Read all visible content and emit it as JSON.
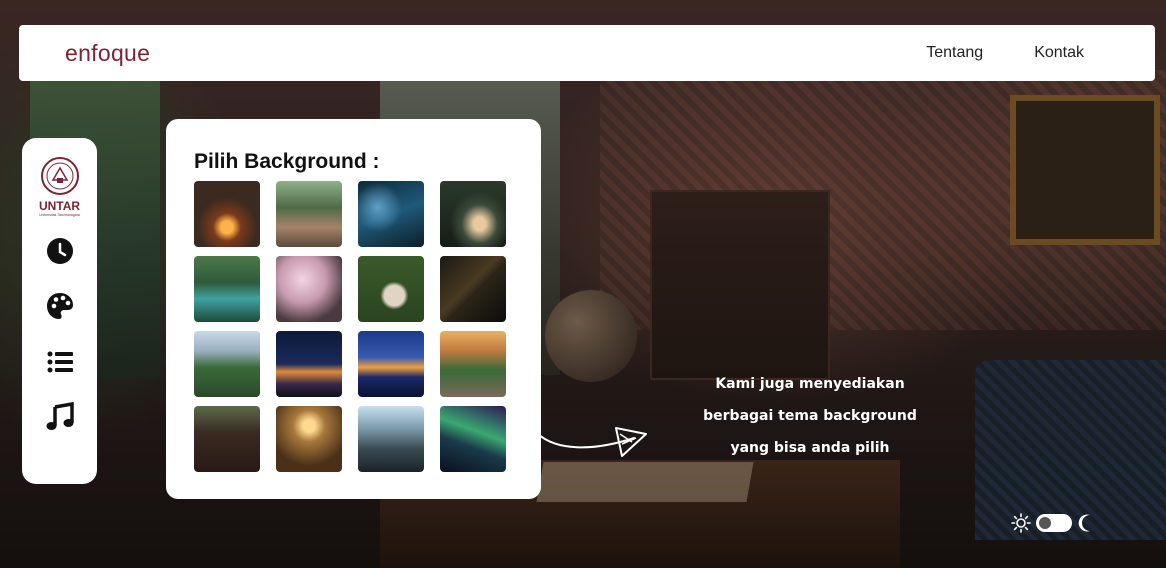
{
  "navbar": {
    "brand": "enfoque",
    "links": [
      {
        "label": "Tentang"
      },
      {
        "label": "Kontak"
      }
    ]
  },
  "sidebar": {
    "logo_text": "UNTAR",
    "logo_subtext": "Universitas Tarumanagara",
    "buttons": [
      {
        "icon": "clock-icon"
      },
      {
        "icon": "palette-icon"
      },
      {
        "icon": "list-icon"
      },
      {
        "icon": "music-note-icon"
      }
    ]
  },
  "picker": {
    "title": "Pilih Background :",
    "thumbnails": [
      {
        "subject": "fireplace room"
      },
      {
        "subject": "friends by campfire"
      },
      {
        "subject": "rainy city aerial"
      },
      {
        "subject": "lakeside cabin at night"
      },
      {
        "subject": "forest river"
      },
      {
        "subject": "cherry blossom reflection"
      },
      {
        "subject": "picnic on grass"
      },
      {
        "subject": "rainy window"
      },
      {
        "subject": "park with skyline"
      },
      {
        "subject": "city skyline at dusk"
      },
      {
        "subject": "city lights reflection"
      },
      {
        "subject": "sunset country road"
      },
      {
        "subject": "old library room"
      },
      {
        "subject": "chandelier hall"
      },
      {
        "subject": "aerial lounge"
      },
      {
        "subject": "aurora borealis"
      }
    ]
  },
  "caption": {
    "line1": "Kami juga menyediakan",
    "line2": "berbagai tema background",
    "line3": "yang bisa anda pilih"
  },
  "theme_toggle": {
    "left_icon": "sun-icon",
    "right_icon": "moon-icon",
    "state": "light"
  },
  "colors": {
    "brand": "#7a2535",
    "panel_bg": "#ffffff",
    "icon_color": "#111111"
  }
}
